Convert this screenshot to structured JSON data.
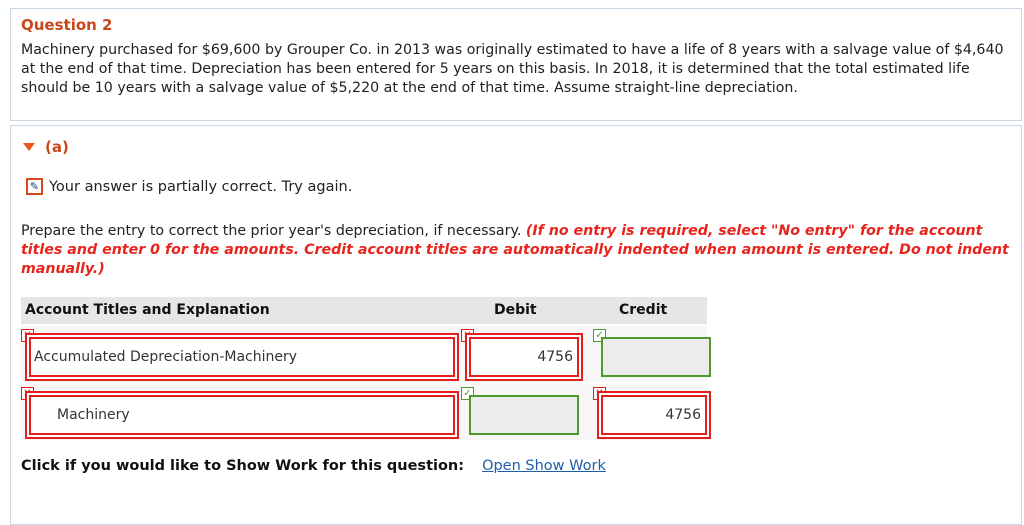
{
  "question": {
    "title": "Question 2",
    "text": "Machinery purchased for $69,600 by Grouper Co. in 2013 was originally estimated to have a life of 8 years with a salvage value of $4,640 at the end of that time. Depreciation has been entered for 5 years on this basis. In 2018, it is determined that the total estimated life should be 10 years with a salvage value of $5,220 at the end of that time. Assume straight-line depreciation."
  },
  "part": {
    "label": "(a)",
    "feedback": "Your answer is partially correct.  Try again.",
    "instruction": "Prepare the entry to correct the prior year's depreciation, if necessary.",
    "instruction_emphasis": "(If no entry is required, select \"No entry\" for the account titles and enter 0 for the amounts. Credit account titles are automatically indented when amount is entered. Do not indent manually.)"
  },
  "journal": {
    "headers": {
      "account": "Account Titles and Explanation",
      "debit": "Debit",
      "credit": "Credit"
    },
    "rows": [
      {
        "account": "Accumulated Depreciation-Machinery",
        "debit": "4756",
        "credit": ""
      },
      {
        "account": "Machinery",
        "debit": "",
        "credit": "4756"
      }
    ],
    "marks": {
      "wrong": "✕",
      "right": "✓"
    }
  },
  "show_work": {
    "label": "Click if you would like to Show Work for this question:",
    "link": "Open Show Work"
  },
  "colors": {
    "title_orange": "#c8471b",
    "error_red": "#e41d1d",
    "correct_green": "#4f9a2f",
    "link_blue": "#1d5fa9"
  }
}
